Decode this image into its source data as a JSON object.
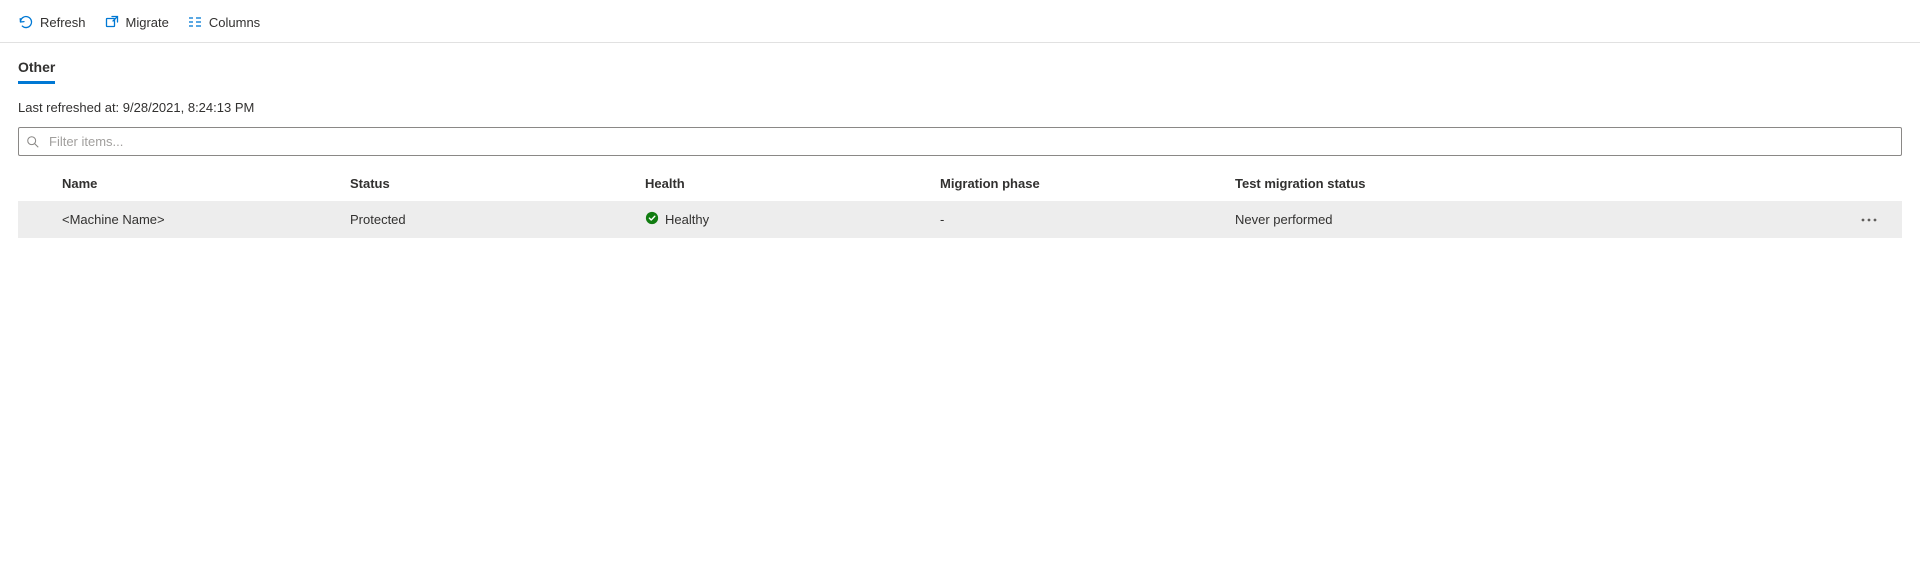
{
  "toolbar": {
    "refresh_label": "Refresh",
    "migrate_label": "Migrate",
    "columns_label": "Columns"
  },
  "tabs": {
    "active": "Other"
  },
  "refresh_status": "Last refreshed at: 9/28/2021, 8:24:13 PM",
  "filter": {
    "placeholder": "Filter items..."
  },
  "table": {
    "headers": {
      "name": "Name",
      "status": "Status",
      "health": "Health",
      "migration_phase": "Migration phase",
      "test_migration_status": "Test migration status"
    },
    "rows": [
      {
        "name": "<Machine Name>",
        "status": "Protected",
        "health": "Healthy",
        "migration_phase": "-",
        "test_migration_status": "Never performed"
      }
    ]
  },
  "colors": {
    "accent": "#0078d4",
    "success": "#107c10"
  }
}
